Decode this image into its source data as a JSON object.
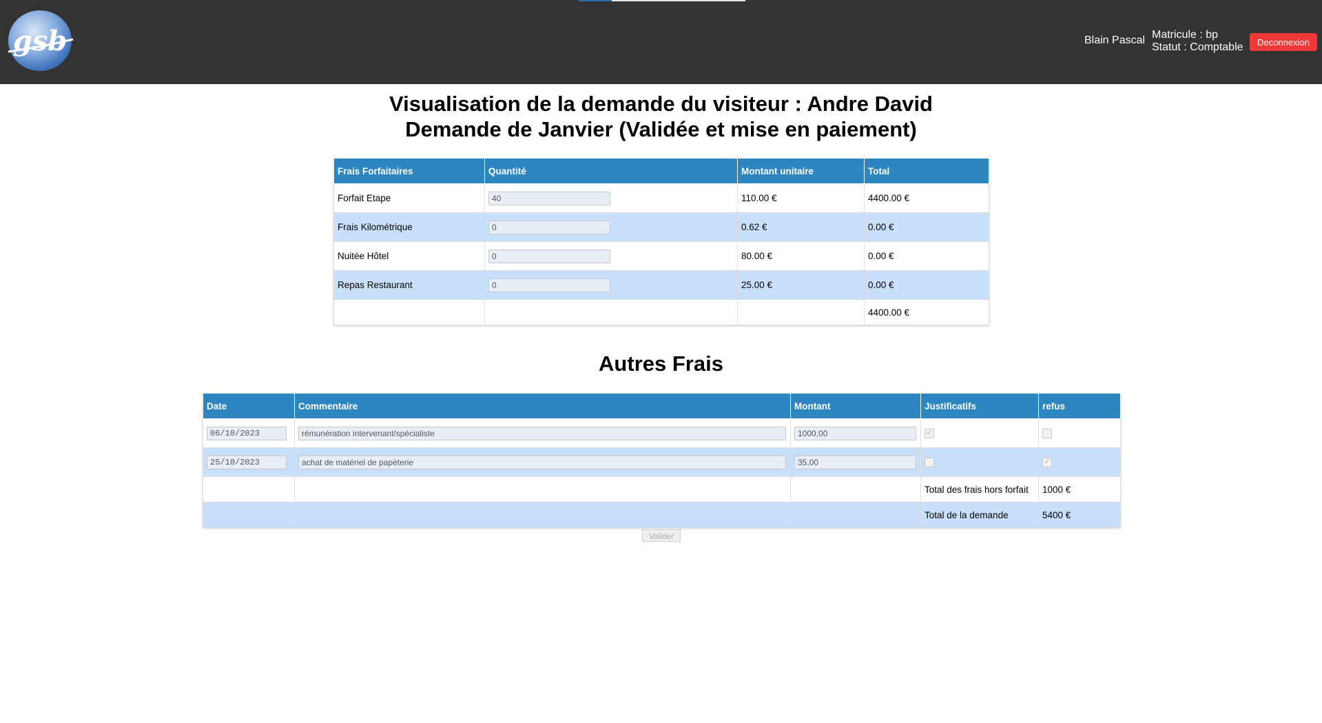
{
  "header": {
    "logo_text": "gsb",
    "user_name": "Blain Pascal",
    "matricule": "Matricule : bp",
    "statut": "Statut : Comptable",
    "logout_label": "Deconnexion"
  },
  "page": {
    "title": "Visualisation de la demande du visiteur : Andre David",
    "subtitle": "Demande de Janvier (Validée et mise en paiement)"
  },
  "forfait": {
    "headers": [
      "Frais Forfaitaires",
      "Quantité",
      "Montant unitaire",
      "Total"
    ],
    "rows": [
      {
        "label": "Forfait Etape",
        "qty": "40",
        "unit": "110.00 €",
        "total": "4400.00 €"
      },
      {
        "label": "Frais Kilométrique",
        "qty": "0",
        "unit": "0.62 €",
        "total": "0.00 €"
      },
      {
        "label": "Nuitée Hôtel",
        "qty": "0",
        "unit": "80.00 €",
        "total": "0.00 €"
      },
      {
        "label": "Repas Restaurant",
        "qty": "0",
        "unit": "25.00 €",
        "total": "0.00 €"
      }
    ],
    "grand_total": "4400.00 €"
  },
  "autres": {
    "title": "Autres Frais",
    "headers": [
      "Date",
      "Commentaire",
      "Montant",
      "Justificatifs",
      "refus"
    ],
    "rows": [
      {
        "date": "06/10/2023",
        "comment": "rémunération intervenant/spécialiste",
        "montant": "1000,00",
        "justificatif": true,
        "refus": false
      },
      {
        "date": "25/10/2023",
        "comment": "achat de matériel de papèterie",
        "montant": "35,00",
        "justificatif": false,
        "refus": true
      }
    ],
    "total_hors_forfait_label": "Total des frais hors forfait",
    "total_hors_forfait": "1000 €",
    "total_demande_label": "Total de la demande",
    "total_demande": "5400 €"
  },
  "actions": {
    "validate_label": "Valider"
  },
  "colors": {
    "header_bg": "#333333",
    "table_header": "#2e86c1",
    "row_alt": "#c8e0fa",
    "logout": "#f03a3a"
  }
}
